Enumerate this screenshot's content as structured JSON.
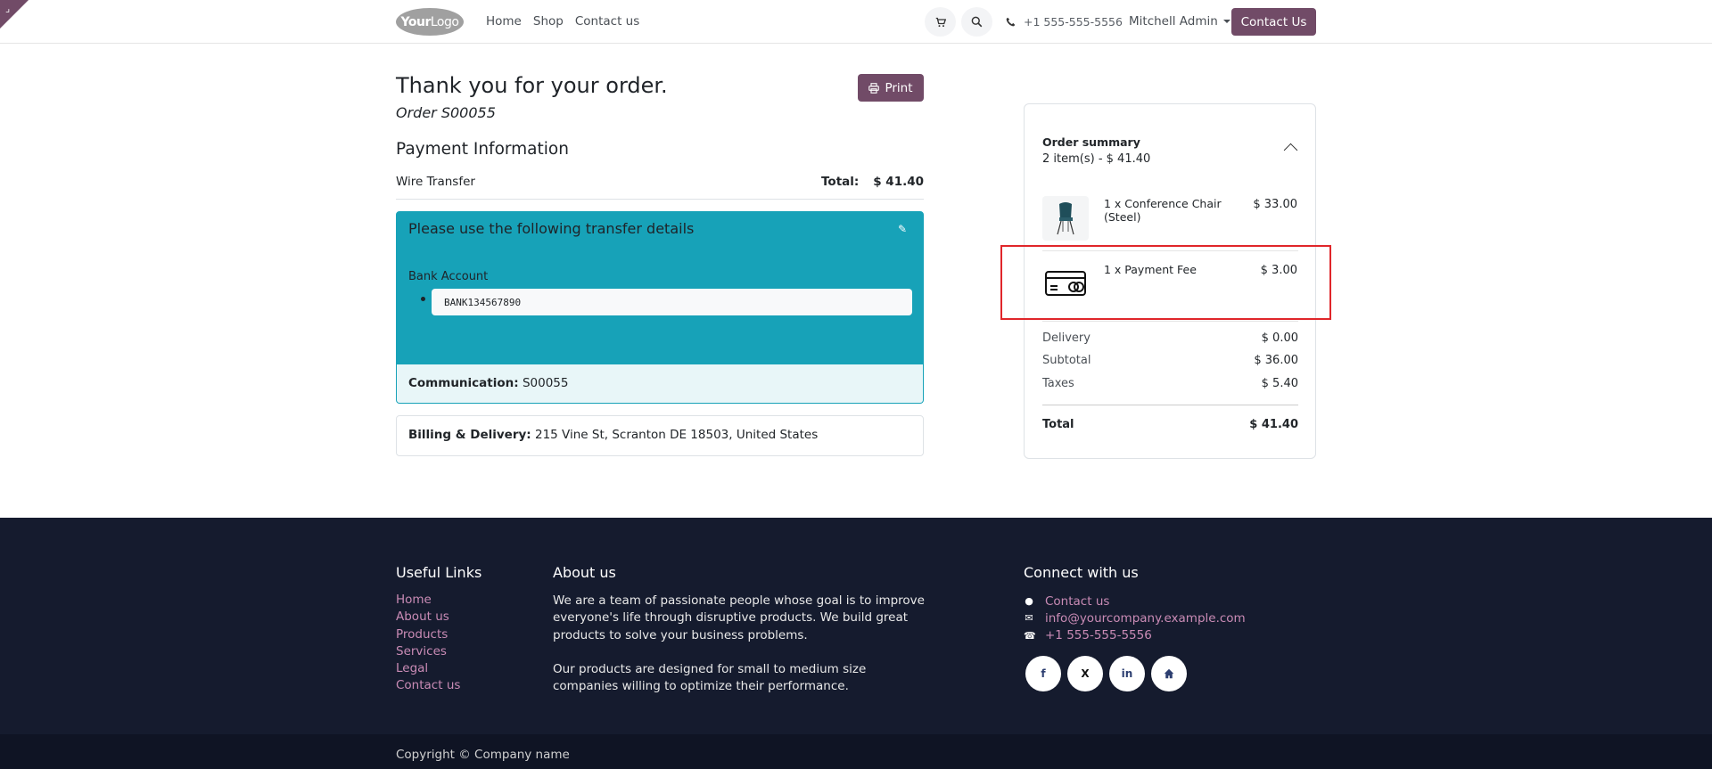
{
  "header": {
    "logo_text_bold": "Your",
    "logo_text_light": "Logo",
    "nav": [
      "Home",
      "Shop",
      "Contact us"
    ],
    "phone": "+1 555-555-5556",
    "user": "Mitchell Admin",
    "cta": "Contact Us"
  },
  "order": {
    "title": "Thank you for your order.",
    "reference": "Order S00055",
    "print_label": "Print",
    "payment_title": "Payment Information",
    "payment_method": "Wire Transfer",
    "total_label": "Total:",
    "total_value": "$ 41.40",
    "transfer_heading": "Please use the following transfer details",
    "bank_label": "Bank Account",
    "bank_account": "BANK134567890",
    "communication_label": "Communication:",
    "communication_value": " S00055",
    "billing_label": "Billing & Delivery:",
    "billing_value": " 215 Vine St, Scranton DE 18503, United States"
  },
  "summary": {
    "title": "Order summary",
    "subtitle": "2 item(s) -  $ 41.40",
    "items": [
      {
        "name": "1 x Conference Chair (Steel)",
        "price": "$ 33.00"
      },
      {
        "name": "1 x Payment Fee",
        "price": "$ 3.00"
      }
    ],
    "totals": [
      {
        "label": "Delivery",
        "value": "$ 0.00"
      },
      {
        "label": "Subtotal",
        "value": "$ 36.00"
      },
      {
        "label": "Taxes",
        "value": "$ 5.40"
      }
    ],
    "grand_label": "Total",
    "grand_value": "$ 41.40"
  },
  "footer": {
    "useful_title": "Useful Links",
    "links": [
      "Home",
      "About us",
      "Products",
      "Services",
      "Legal",
      "Contact us"
    ],
    "about_title": "About us",
    "about_p1": "We are a team of passionate people whose goal is to improve everyone's life through disruptive products. We build great products to solve your business problems.",
    "about_p2": "Our products are designed for small to medium size companies willing to optimize their performance.",
    "connect_title": "Connect with us",
    "connect": [
      "Contact us",
      "info@yourcompany.example.com",
      "+1 555-555-5556"
    ],
    "socials": [
      "f",
      "X",
      "in",
      "home"
    ],
    "copyright": "Copyright © Company name"
  },
  "colors": {
    "brand": "#714b67",
    "info": "#17a2b8",
    "footer_bg": "#151b2e",
    "highlight": "#e0262a"
  }
}
